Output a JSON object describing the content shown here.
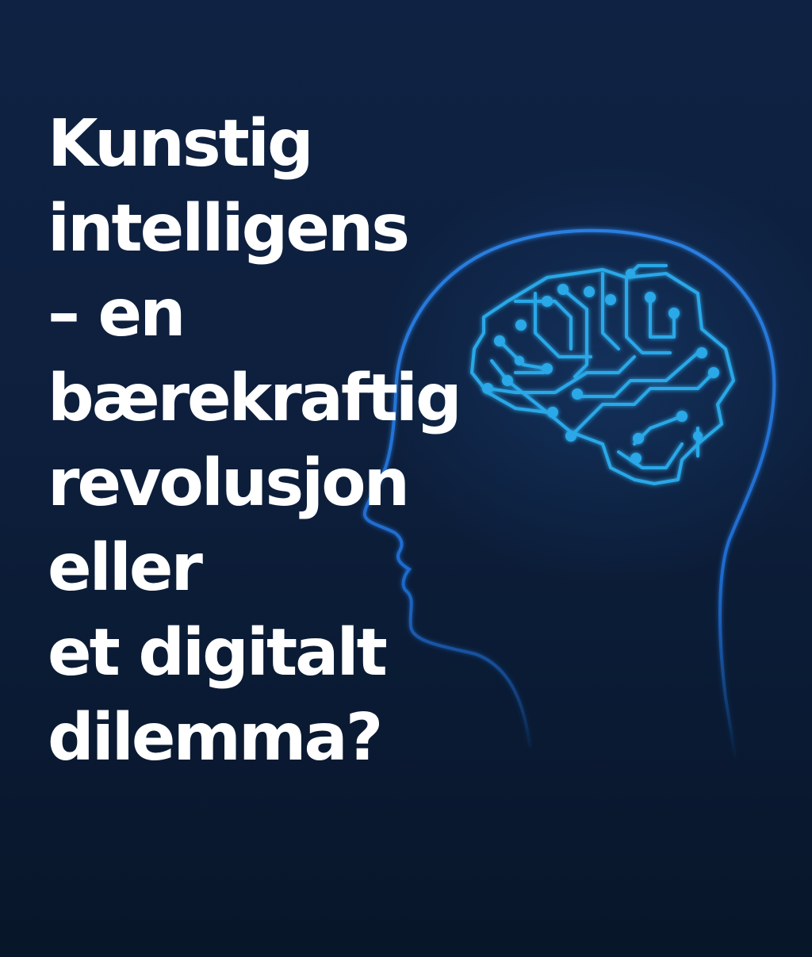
{
  "headline": {
    "lines": [
      "Kunstig",
      "intelligens",
      "– en",
      "bærekraftig",
      "revolusjon",
      "eller",
      "et digitalt",
      "dilemma?"
    ]
  },
  "illustration": {
    "icon": "head-brain-circuit-icon",
    "outline_color": "#1f6fd6",
    "circuit_color": "#2aa8e8",
    "background_color": "#0c1c36",
    "text_color": "#ffffff"
  }
}
